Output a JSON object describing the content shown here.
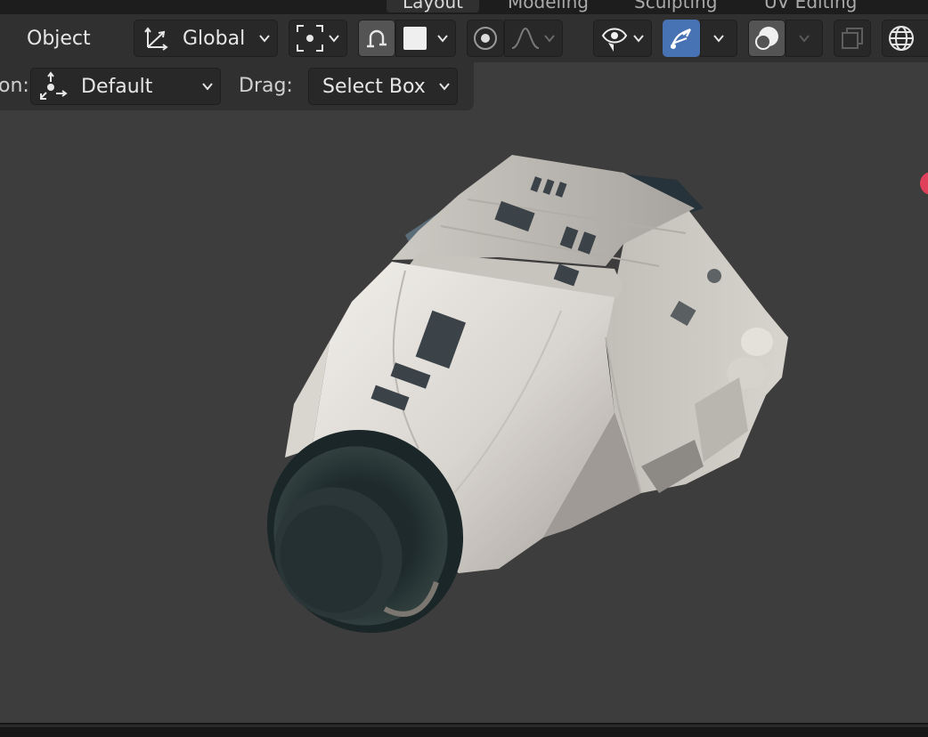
{
  "workspace_tabs": [
    "Layout",
    "Modeling",
    "Sculpting",
    "UV Editing"
  ],
  "header": {
    "mode_label": "Object",
    "transform_orientation": "Global"
  },
  "tool_settings": {
    "orientation_label": "on:",
    "orientation_value": "Default",
    "drag_label": "Drag:",
    "drag_value": "Select Box"
  },
  "colors": {
    "accent": "#4772b3",
    "viewport_bg": "#3d3d3d",
    "header_bg": "#303030",
    "gizmo_x": "#e0405a"
  },
  "icons": [
    "transform-orientation-icon",
    "pivot-point-icon",
    "snap-magnet-icon",
    "snap-increment-icon",
    "proportional-editing-icon",
    "falloff-curve-icon",
    "visibility-eye-icon",
    "gizmo-icon",
    "overlays-icon",
    "xray-icon",
    "wireframe-shading-icon"
  ]
}
